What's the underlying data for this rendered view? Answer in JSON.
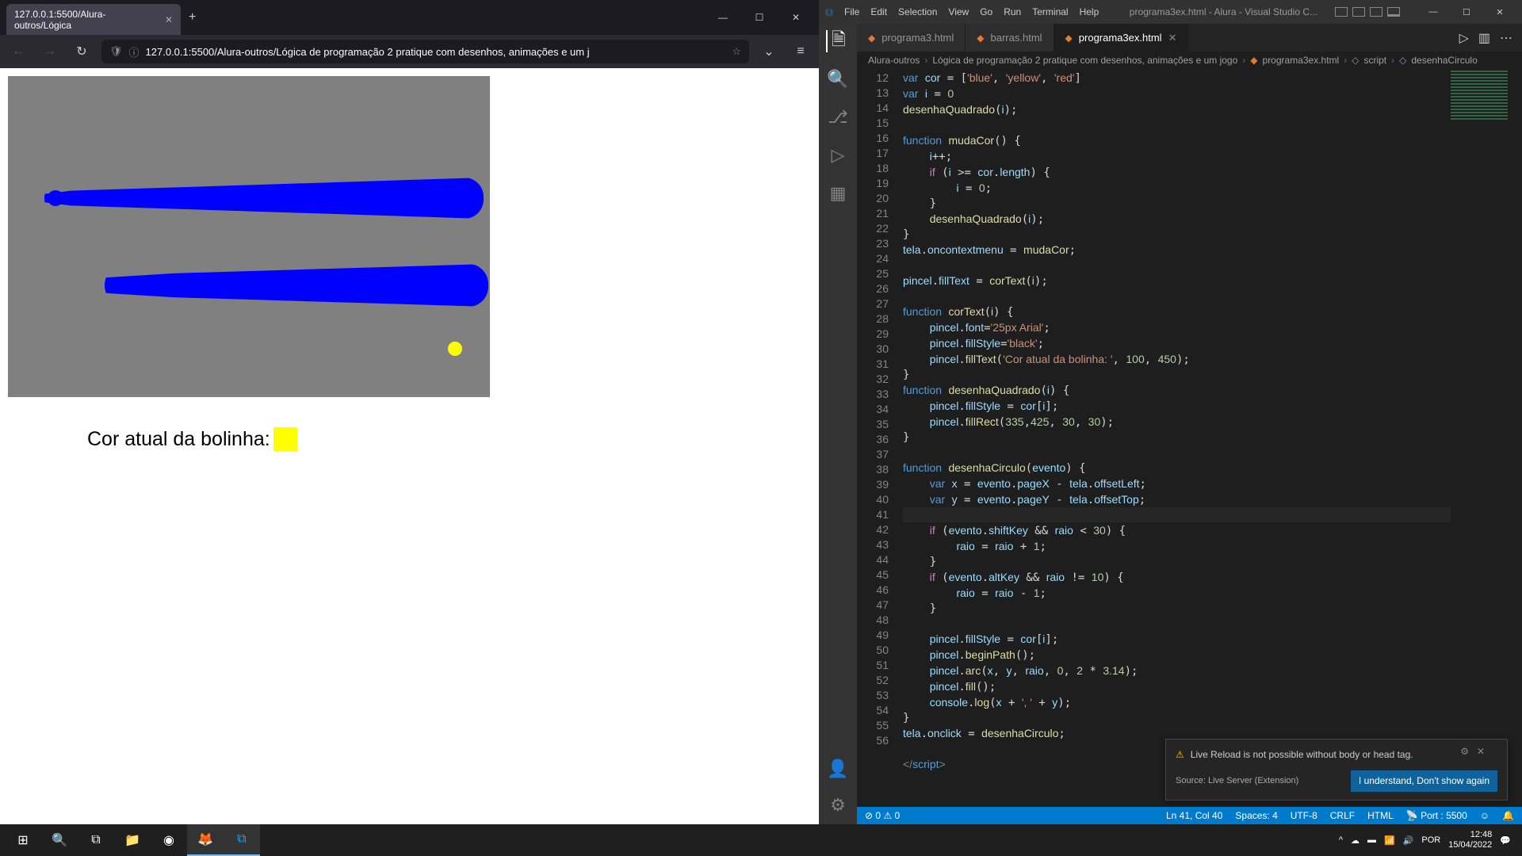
{
  "browser": {
    "tab_title": "127.0.0.1:5500/Alura-outros/Lógica",
    "url": "127.0.0.1:5500/Alura-outros/Lógica de programação 2 pratique com desenhos, animações e um j",
    "page_label": "Cor atual da bolinha:"
  },
  "vscode": {
    "menu": [
      "File",
      "Edit",
      "Selection",
      "View",
      "Go",
      "Run",
      "Terminal",
      "Help"
    ],
    "window_title": "programa3ex.html - Alura - Visual Studio C...",
    "tabs": [
      {
        "name": "programa3.html",
        "active": false
      },
      {
        "name": "barras.html",
        "active": false
      },
      {
        "name": "programa3ex.html",
        "active": true
      }
    ],
    "breadcrumb": [
      "Alura-outros",
      "Lógica de programação 2 pratique com desenhos, animações e um jogo",
      "programa3ex.html",
      "script",
      "desenhaCirculo"
    ],
    "lines": [
      12,
      13,
      14,
      15,
      16,
      17,
      18,
      19,
      20,
      21,
      22,
      23,
      24,
      25,
      26,
      27,
      28,
      29,
      30,
      31,
      32,
      33,
      34,
      35,
      36,
      37,
      38,
      39,
      40,
      41,
      42,
      43,
      44,
      45,
      46,
      47,
      48,
      49,
      50,
      51,
      52,
      53,
      54,
      55,
      56
    ],
    "notif": {
      "msg": "Live Reload is not possible without body or head tag.",
      "source": "Source: Live Server (Extension)",
      "button": "I understand, Don't show again"
    },
    "status": {
      "errors": "0",
      "warnings": "0",
      "cursor": "Ln 41, Col 40",
      "spaces": "Spaces: 4",
      "enc": "UTF-8",
      "eol": "CRLF",
      "lang": "HTML",
      "port": "Port : 5500"
    }
  },
  "tray": {
    "time": "12:48",
    "date": "15/04/2022"
  }
}
